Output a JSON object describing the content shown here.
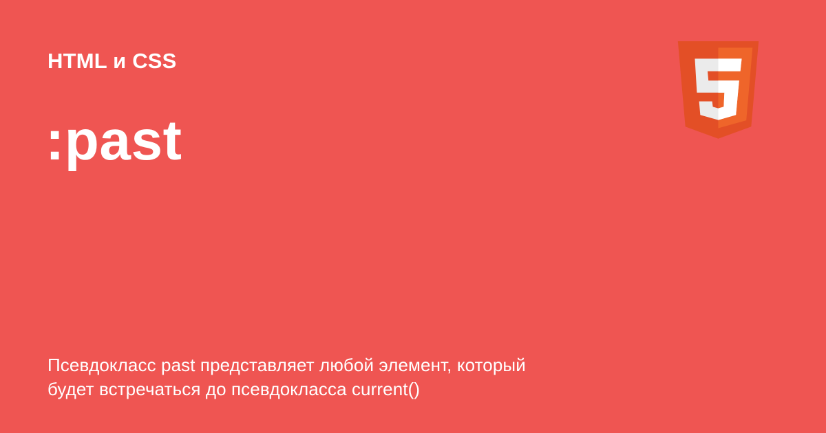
{
  "header": {
    "category": "HTML и CSS"
  },
  "main": {
    "title": ":past",
    "description_lines": [
      "Псевдокласс past представляет любой элемент, который",
      "будет встречаться до псевдокласса current()"
    ]
  },
  "logo": {
    "icon": "html5-shield-icon",
    "glyph": "5"
  },
  "colors": {
    "background": "#ef5552",
    "text": "#ffffff",
    "logo_dark": "#e34f26",
    "logo_light": "#ef652a"
  }
}
